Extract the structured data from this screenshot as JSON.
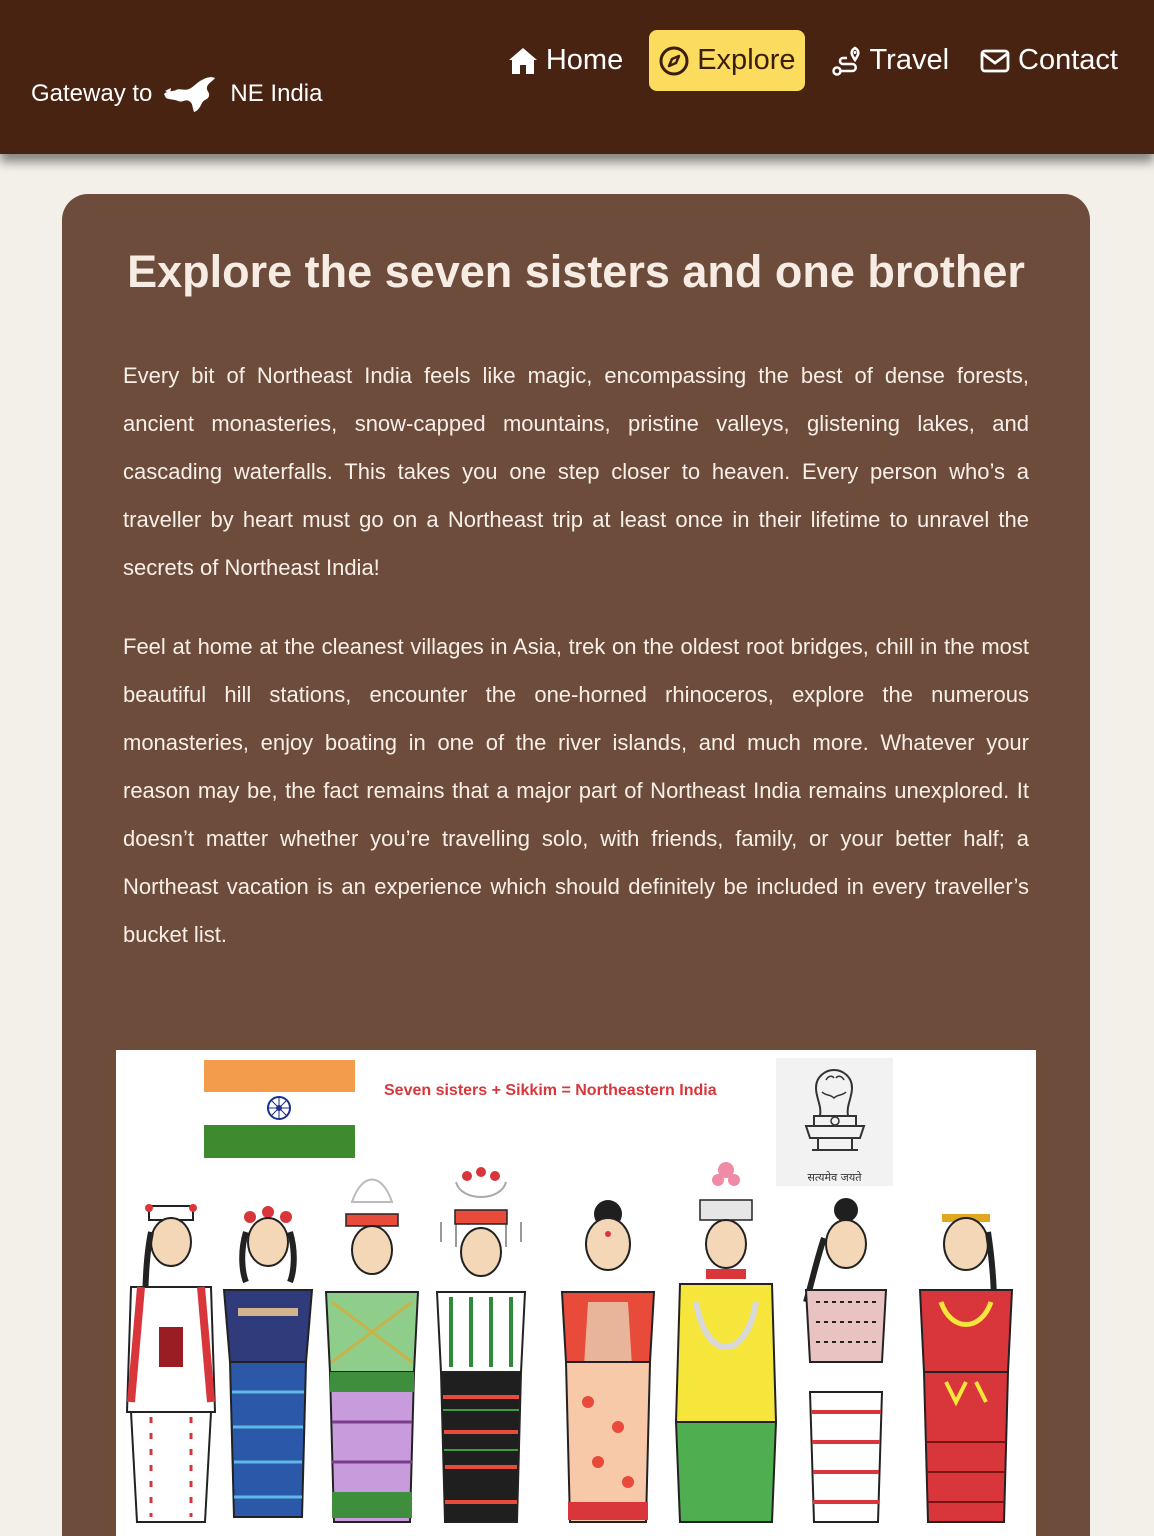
{
  "brand": {
    "prefix": "Gateway to",
    "suffix": "NE India",
    "logo_icon": "northeast-map-icon"
  },
  "nav": [
    {
      "label": "Home",
      "icon": "home-icon",
      "active": false
    },
    {
      "label": "Explore",
      "icon": "compass-icon",
      "active": true
    },
    {
      "label": "Travel",
      "icon": "route-icon",
      "active": false
    },
    {
      "label": "Contact",
      "icon": "envelope-icon",
      "active": false
    }
  ],
  "main": {
    "title": "Explore the seven sisters and one brother",
    "paragraphs": [
      "Every bit of Northeast India feels like magic, encompassing the best of dense forests, ancient monasteries, snow-capped mountains, pristine valleys, glistening lakes, and cascading waterfalls. This takes you one step closer to heaven. Every person who’s a traveller by heart must go on a Northeast trip at least once in their lifetime to unravel the secrets of Northeast India!",
      "Feel at home at the cleanest villages in Asia, trek on the oldest root bridges, chill in the most beautiful hill stations, encounter the one-horned rhinoceros, explore the numerous monasteries, enjoy boating in one of the river islands, and much more. Whatever your reason may be, the fact remains that a major part of Northeast India remains unexplored. It doesn’t matter whether you’re travelling solo, with friends, family, or your better half; a Northeast vacation is an experience which should definitely be included in every traveller’s bucket list."
    ]
  },
  "illustration": {
    "caption": "Seven sisters + Sikkim = Northeastern India",
    "emblem_motto": "सत्यमेव जयते",
    "figure_count": 8
  },
  "colors": {
    "nav_bg": "#482312",
    "active_nav_bg": "#fbdc5f",
    "card_bg": "#6e4c3c",
    "page_bg": "#f3efe9",
    "caption_red": "#d9363b"
  }
}
